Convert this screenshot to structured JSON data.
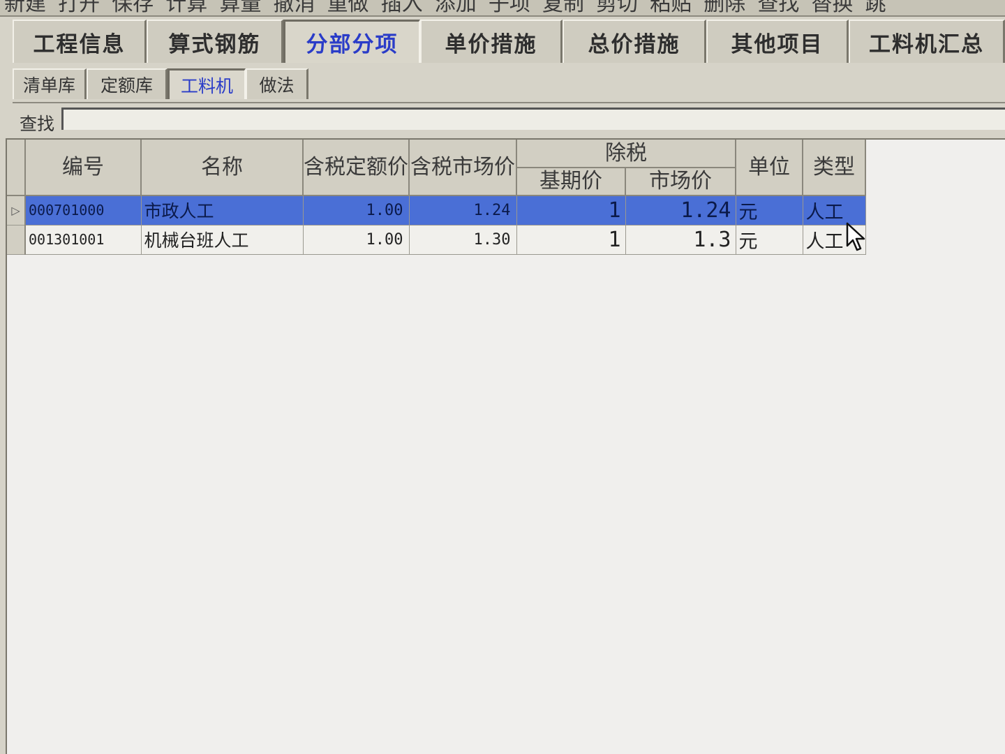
{
  "toolbar": {
    "items": [
      "新建",
      "打开",
      "保存",
      "计算",
      "算量",
      "撤消",
      "重做",
      "插入",
      "添加",
      "子项",
      "复制",
      "剪切",
      "粘贴",
      "删除",
      "查找",
      "替换",
      "跳"
    ]
  },
  "main_tabs": [
    {
      "label": "工程信息"
    },
    {
      "label": "算式钢筋"
    },
    {
      "label": "分部分项"
    },
    {
      "label": "单价措施"
    },
    {
      "label": "总价措施"
    },
    {
      "label": "其他项目"
    },
    {
      "label": "工料机汇总"
    }
  ],
  "sub_tabs": [
    {
      "label": "清单库"
    },
    {
      "label": "定额库"
    },
    {
      "label": "工料机"
    },
    {
      "label": "做法"
    }
  ],
  "search": {
    "label": "查找",
    "value": ""
  },
  "grid": {
    "headers": {
      "code": "编号",
      "name": "名称",
      "tax_quota_price": "含税定额价",
      "tax_market_price": "含税市场价",
      "ex_tax": "除税",
      "base_price": "基期价",
      "market_price": "市场价",
      "unit": "单位",
      "type": "类型"
    },
    "rows": [
      {
        "indicator": "▷",
        "code": "000701000",
        "name": "市政人工",
        "tax_quota_price": "1.00",
        "tax_market_price": "1.24",
        "base_price": "1",
        "market_price": "1.24",
        "unit": "元",
        "type": "人工",
        "selected": true
      },
      {
        "indicator": "",
        "code": "001301001",
        "name": "机械台班人工",
        "tax_quota_price": "1.00",
        "tax_market_price": "1.30",
        "base_price": "1",
        "market_price": "1.3",
        "unit": "元",
        "type": "人工",
        "selected": false
      }
    ]
  },
  "colors": {
    "selection": "#4a6fd6",
    "active_tab_text": "#2a3cc8",
    "chrome": "#d6d3c8"
  }
}
